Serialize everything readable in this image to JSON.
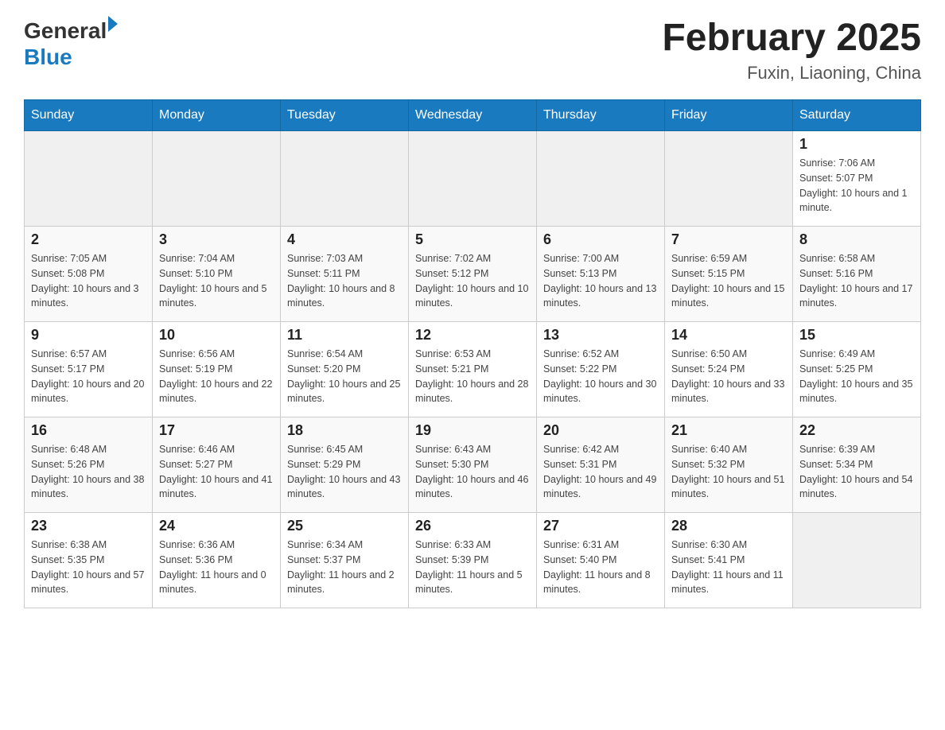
{
  "header": {
    "logo_general": "General",
    "logo_blue": "Blue",
    "month_title": "February 2025",
    "location": "Fuxin, Liaoning, China"
  },
  "weekdays": [
    "Sunday",
    "Monday",
    "Tuesday",
    "Wednesday",
    "Thursday",
    "Friday",
    "Saturday"
  ],
  "weeks": [
    [
      {
        "day": "",
        "info": ""
      },
      {
        "day": "",
        "info": ""
      },
      {
        "day": "",
        "info": ""
      },
      {
        "day": "",
        "info": ""
      },
      {
        "day": "",
        "info": ""
      },
      {
        "day": "",
        "info": ""
      },
      {
        "day": "1",
        "info": "Sunrise: 7:06 AM\nSunset: 5:07 PM\nDaylight: 10 hours and 1 minute."
      }
    ],
    [
      {
        "day": "2",
        "info": "Sunrise: 7:05 AM\nSunset: 5:08 PM\nDaylight: 10 hours and 3 minutes."
      },
      {
        "day": "3",
        "info": "Sunrise: 7:04 AM\nSunset: 5:10 PM\nDaylight: 10 hours and 5 minutes."
      },
      {
        "day": "4",
        "info": "Sunrise: 7:03 AM\nSunset: 5:11 PM\nDaylight: 10 hours and 8 minutes."
      },
      {
        "day": "5",
        "info": "Sunrise: 7:02 AM\nSunset: 5:12 PM\nDaylight: 10 hours and 10 minutes."
      },
      {
        "day": "6",
        "info": "Sunrise: 7:00 AM\nSunset: 5:13 PM\nDaylight: 10 hours and 13 minutes."
      },
      {
        "day": "7",
        "info": "Sunrise: 6:59 AM\nSunset: 5:15 PM\nDaylight: 10 hours and 15 minutes."
      },
      {
        "day": "8",
        "info": "Sunrise: 6:58 AM\nSunset: 5:16 PM\nDaylight: 10 hours and 17 minutes."
      }
    ],
    [
      {
        "day": "9",
        "info": "Sunrise: 6:57 AM\nSunset: 5:17 PM\nDaylight: 10 hours and 20 minutes."
      },
      {
        "day": "10",
        "info": "Sunrise: 6:56 AM\nSunset: 5:19 PM\nDaylight: 10 hours and 22 minutes."
      },
      {
        "day": "11",
        "info": "Sunrise: 6:54 AM\nSunset: 5:20 PM\nDaylight: 10 hours and 25 minutes."
      },
      {
        "day": "12",
        "info": "Sunrise: 6:53 AM\nSunset: 5:21 PM\nDaylight: 10 hours and 28 minutes."
      },
      {
        "day": "13",
        "info": "Sunrise: 6:52 AM\nSunset: 5:22 PM\nDaylight: 10 hours and 30 minutes."
      },
      {
        "day": "14",
        "info": "Sunrise: 6:50 AM\nSunset: 5:24 PM\nDaylight: 10 hours and 33 minutes."
      },
      {
        "day": "15",
        "info": "Sunrise: 6:49 AM\nSunset: 5:25 PM\nDaylight: 10 hours and 35 minutes."
      }
    ],
    [
      {
        "day": "16",
        "info": "Sunrise: 6:48 AM\nSunset: 5:26 PM\nDaylight: 10 hours and 38 minutes."
      },
      {
        "day": "17",
        "info": "Sunrise: 6:46 AM\nSunset: 5:27 PM\nDaylight: 10 hours and 41 minutes."
      },
      {
        "day": "18",
        "info": "Sunrise: 6:45 AM\nSunset: 5:29 PM\nDaylight: 10 hours and 43 minutes."
      },
      {
        "day": "19",
        "info": "Sunrise: 6:43 AM\nSunset: 5:30 PM\nDaylight: 10 hours and 46 minutes."
      },
      {
        "day": "20",
        "info": "Sunrise: 6:42 AM\nSunset: 5:31 PM\nDaylight: 10 hours and 49 minutes."
      },
      {
        "day": "21",
        "info": "Sunrise: 6:40 AM\nSunset: 5:32 PM\nDaylight: 10 hours and 51 minutes."
      },
      {
        "day": "22",
        "info": "Sunrise: 6:39 AM\nSunset: 5:34 PM\nDaylight: 10 hours and 54 minutes."
      }
    ],
    [
      {
        "day": "23",
        "info": "Sunrise: 6:38 AM\nSunset: 5:35 PM\nDaylight: 10 hours and 57 minutes."
      },
      {
        "day": "24",
        "info": "Sunrise: 6:36 AM\nSunset: 5:36 PM\nDaylight: 11 hours and 0 minutes."
      },
      {
        "day": "25",
        "info": "Sunrise: 6:34 AM\nSunset: 5:37 PM\nDaylight: 11 hours and 2 minutes."
      },
      {
        "day": "26",
        "info": "Sunrise: 6:33 AM\nSunset: 5:39 PM\nDaylight: 11 hours and 5 minutes."
      },
      {
        "day": "27",
        "info": "Sunrise: 6:31 AM\nSunset: 5:40 PM\nDaylight: 11 hours and 8 minutes."
      },
      {
        "day": "28",
        "info": "Sunrise: 6:30 AM\nSunset: 5:41 PM\nDaylight: 11 hours and 11 minutes."
      },
      {
        "day": "",
        "info": ""
      }
    ]
  ]
}
